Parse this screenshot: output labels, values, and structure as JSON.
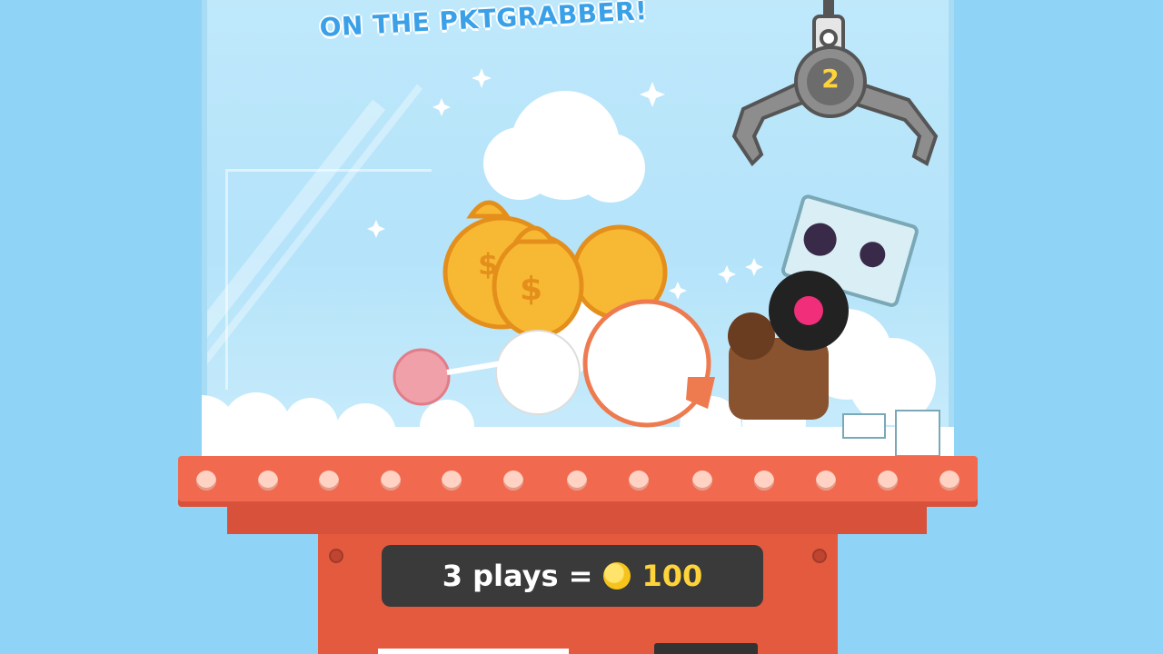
{
  "banner": {
    "subtitle": "ON THE PKTGRABBER!"
  },
  "claw": {
    "counter": "2"
  },
  "display": {
    "plays": "3 plays =",
    "price": "100"
  },
  "prizes": [
    "money-bags",
    "lollipop-bunny",
    "cookie",
    "chocolate-character",
    "cassette-tape",
    "vinyl-record"
  ],
  "colors": {
    "sky": "#8fd3f7",
    "machine": "#f16a4f",
    "display": "#3a3a3a",
    "coin": "#ffd43a"
  }
}
